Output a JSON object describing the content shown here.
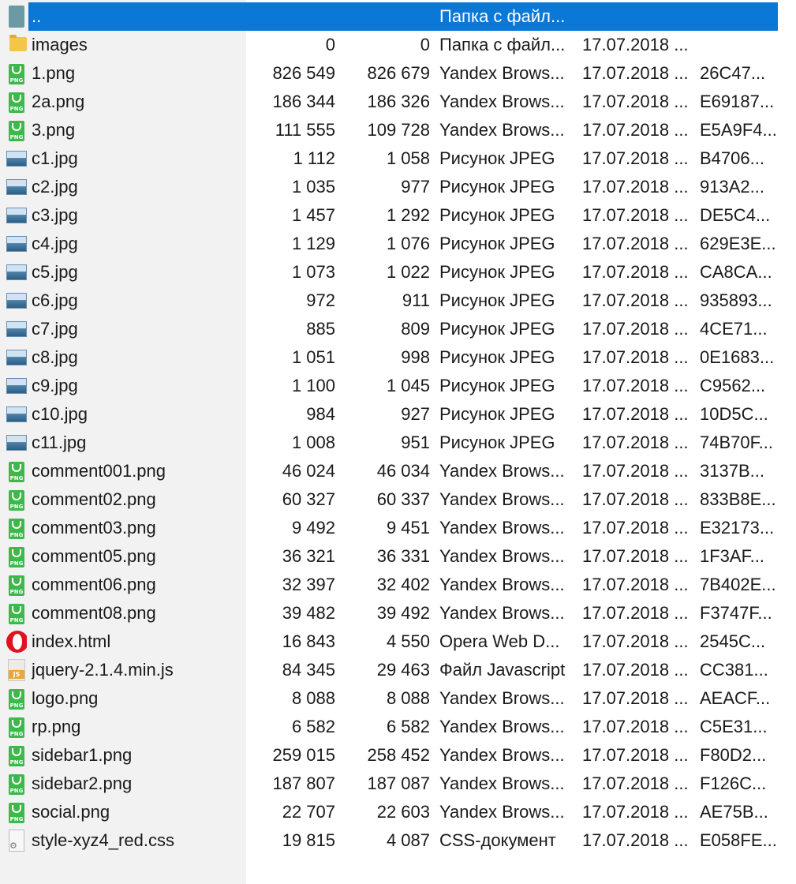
{
  "files": [
    {
      "icon": "up-folder-icon",
      "name": "..",
      "size": "",
      "packed": "",
      "type": "Папка с файл...",
      "date": "",
      "crc": "",
      "selected": true
    },
    {
      "icon": "folder-icon",
      "name": "images",
      "size": "0",
      "packed": "0",
      "type": "Папка с файл...",
      "date": "17.07.2018 ...",
      "crc": ""
    },
    {
      "icon": "png-file-icon",
      "name": "1.png",
      "size": "826 549",
      "packed": "826 679",
      "type": "Yandex Brows...",
      "date": "17.07.2018 ...",
      "crc": "26C47..."
    },
    {
      "icon": "png-file-icon",
      "name": "2a.png",
      "size": "186 344",
      "packed": "186 326",
      "type": "Yandex Brows...",
      "date": "17.07.2018 ...",
      "crc": "E69187..."
    },
    {
      "icon": "png-file-icon",
      "name": "3.png",
      "size": "111 555",
      "packed": "109 728",
      "type": "Yandex Brows...",
      "date": "17.07.2018 ...",
      "crc": "E5A9F4..."
    },
    {
      "icon": "jpeg-file-icon",
      "name": "c1.jpg",
      "size": "1 112",
      "packed": "1 058",
      "type": "Рисунок JPEG",
      "date": "17.07.2018 ...",
      "crc": "B4706..."
    },
    {
      "icon": "jpeg-file-icon",
      "name": "c2.jpg",
      "size": "1 035",
      "packed": "977",
      "type": "Рисунок JPEG",
      "date": "17.07.2018 ...",
      "crc": "913A2..."
    },
    {
      "icon": "jpeg-file-icon",
      "name": "c3.jpg",
      "size": "1 457",
      "packed": "1 292",
      "type": "Рисунок JPEG",
      "date": "17.07.2018 ...",
      "crc": "DE5C4..."
    },
    {
      "icon": "jpeg-file-icon",
      "name": "c4.jpg",
      "size": "1 129",
      "packed": "1 076",
      "type": "Рисунок JPEG",
      "date": "17.07.2018 ...",
      "crc": "629E3E..."
    },
    {
      "icon": "jpeg-file-icon",
      "name": "c5.jpg",
      "size": "1 073",
      "packed": "1 022",
      "type": "Рисунок JPEG",
      "date": "17.07.2018 ...",
      "crc": "CA8CA..."
    },
    {
      "icon": "jpeg-file-icon",
      "name": "c6.jpg",
      "size": "972",
      "packed": "911",
      "type": "Рисунок JPEG",
      "date": "17.07.2018 ...",
      "crc": "935893..."
    },
    {
      "icon": "jpeg-file-icon",
      "name": "c7.jpg",
      "size": "885",
      "packed": "809",
      "type": "Рисунок JPEG",
      "date": "17.07.2018 ...",
      "crc": "4CE71..."
    },
    {
      "icon": "jpeg-file-icon",
      "name": "c8.jpg",
      "size": "1 051",
      "packed": "998",
      "type": "Рисунок JPEG",
      "date": "17.07.2018 ...",
      "crc": "0E1683..."
    },
    {
      "icon": "jpeg-file-icon",
      "name": "c9.jpg",
      "size": "1 100",
      "packed": "1 045",
      "type": "Рисунок JPEG",
      "date": "17.07.2018 ...",
      "crc": "C9562..."
    },
    {
      "icon": "jpeg-file-icon",
      "name": "c10.jpg",
      "size": "984",
      "packed": "927",
      "type": "Рисунок JPEG",
      "date": "17.07.2018 ...",
      "crc": "10D5C..."
    },
    {
      "icon": "jpeg-file-icon",
      "name": "c11.jpg",
      "size": "1 008",
      "packed": "951",
      "type": "Рисунок JPEG",
      "date": "17.07.2018 ...",
      "crc": "74B70F..."
    },
    {
      "icon": "png-file-icon",
      "name": "comment001.png",
      "size": "46 024",
      "packed": "46 034",
      "type": "Yandex Brows...",
      "date": "17.07.2018 ...",
      "crc": "3137B..."
    },
    {
      "icon": "png-file-icon",
      "name": "comment02.png",
      "size": "60 327",
      "packed": "60 337",
      "type": "Yandex Brows...",
      "date": "17.07.2018 ...",
      "crc": "833B8E..."
    },
    {
      "icon": "png-file-icon",
      "name": "comment03.png",
      "size": "9 492",
      "packed": "9 451",
      "type": "Yandex Brows...",
      "date": "17.07.2018 ...",
      "crc": "E32173..."
    },
    {
      "icon": "png-file-icon",
      "name": "comment05.png",
      "size": "36 321",
      "packed": "36 331",
      "type": "Yandex Brows...",
      "date": "17.07.2018 ...",
      "crc": "1F3AF..."
    },
    {
      "icon": "png-file-icon",
      "name": "comment06.png",
      "size": "32 397",
      "packed": "32 402",
      "type": "Yandex Brows...",
      "date": "17.07.2018 ...",
      "crc": "7B402E..."
    },
    {
      "icon": "png-file-icon",
      "name": "comment08.png",
      "size": "39 482",
      "packed": "39 492",
      "type": "Yandex Brows...",
      "date": "17.07.2018 ...",
      "crc": "F3747F..."
    },
    {
      "icon": "opera-icon",
      "name": "index.html",
      "size": "16 843",
      "packed": "4 550",
      "type": "Opera Web D...",
      "date": "17.07.2018 ...",
      "crc": "2545C..."
    },
    {
      "icon": "js-file-icon",
      "name": "jquery-2.1.4.min.js",
      "size": "84 345",
      "packed": "29 463",
      "type": "Файл Javascript",
      "date": "17.07.2018 ...",
      "crc": "CC381..."
    },
    {
      "icon": "png-file-icon",
      "name": "logo.png",
      "size": "8 088",
      "packed": "8 088",
      "type": "Yandex Brows...",
      "date": "17.07.2018 ...",
      "crc": "AEACF..."
    },
    {
      "icon": "png-file-icon",
      "name": "rp.png",
      "size": "6 582",
      "packed": "6 582",
      "type": "Yandex Brows...",
      "date": "17.07.2018 ...",
      "crc": "C5E31..."
    },
    {
      "icon": "png-file-icon",
      "name": "sidebar1.png",
      "size": "259 015",
      "packed": "258 452",
      "type": "Yandex Brows...",
      "date": "17.07.2018 ...",
      "crc": "F80D2..."
    },
    {
      "icon": "png-file-icon",
      "name": "sidebar2.png",
      "size": "187 807",
      "packed": "187 087",
      "type": "Yandex Brows...",
      "date": "17.07.2018 ...",
      "crc": "F126C..."
    },
    {
      "icon": "png-file-icon",
      "name": "social.png",
      "size": "22 707",
      "packed": "22 603",
      "type": "Yandex Brows...",
      "date": "17.07.2018 ...",
      "crc": "AE75B..."
    },
    {
      "icon": "css-file-icon",
      "name": "style-xyz4_red.css",
      "size": "19 815",
      "packed": "4 087",
      "type": "CSS-документ",
      "date": "17.07.2018 ...",
      "crc": "E058FE..."
    }
  ],
  "colors": {
    "selection": "#0a78d7",
    "png": "#3db94a",
    "folder": "#f3c64a"
  }
}
